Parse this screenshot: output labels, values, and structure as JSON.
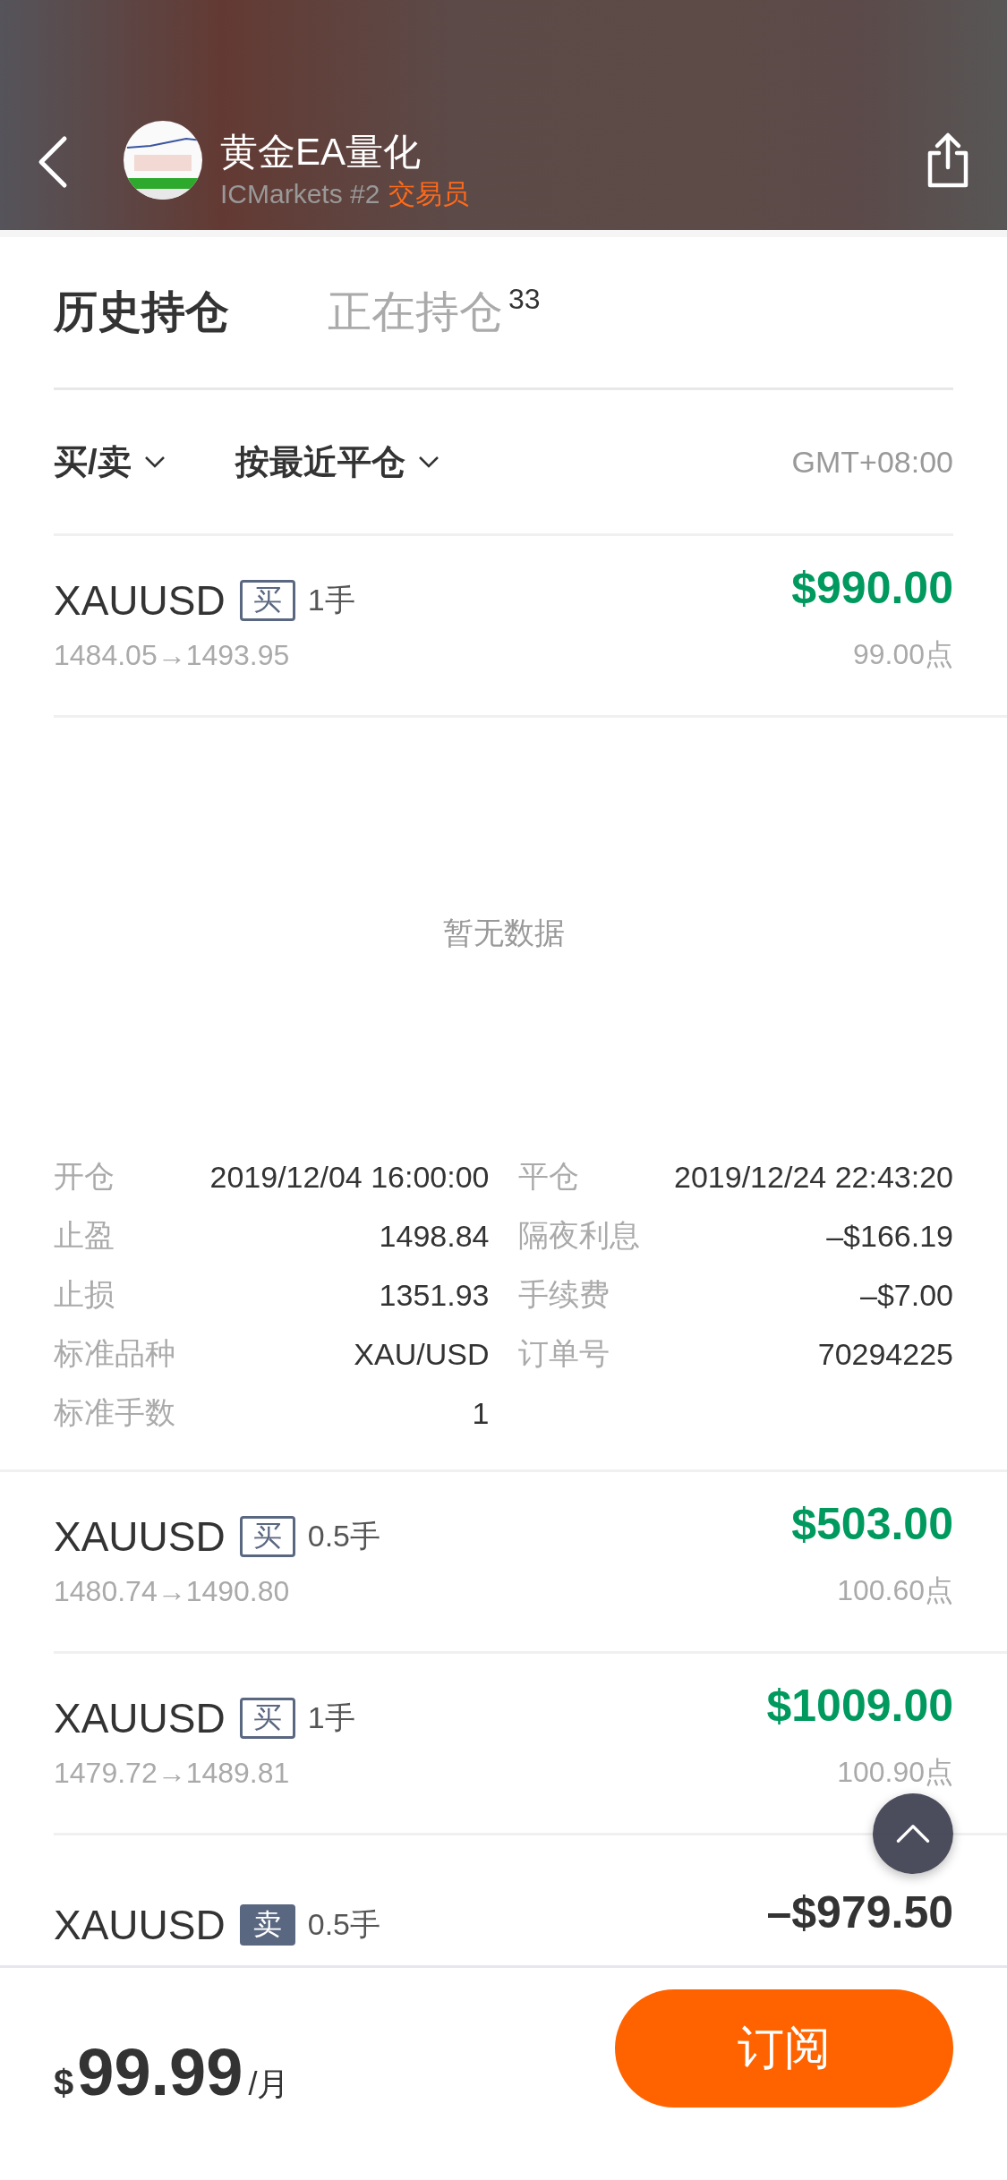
{
  "header": {
    "title": "黄金EA量化",
    "broker": "ICMarkets #2",
    "role": "交易员"
  },
  "tabs": [
    {
      "label": "历史持仓",
      "selected": true
    },
    {
      "label": "正在持仓",
      "count": "33",
      "selected": false
    }
  ],
  "filters": {
    "side": "买/卖",
    "sort": "按最近平仓",
    "timezone": "GMT+08:00"
  },
  "trades": [
    {
      "symbol": "XAUUSD",
      "kind": "buy",
      "side": "买",
      "lots": "1手",
      "prices": "1484.05→1493.95",
      "amount": "$990.00",
      "loss": false,
      "points": "99.00点",
      "empty_text": "暂无数据",
      "details": [
        {
          "label": "开仓",
          "value": "2019/12/04 16:00:00"
        },
        {
          "label": "平仓",
          "value": "2019/12/24 22:43:20"
        },
        {
          "label": "止盈",
          "value": "1498.84"
        },
        {
          "label": "隔夜利息",
          "value": "–$166.19"
        },
        {
          "label": "止损",
          "value": "1351.93"
        },
        {
          "label": "手续费",
          "value": "–$7.00"
        },
        {
          "label": "标准品种",
          "value": "XAU/USD"
        },
        {
          "label": "订单号",
          "value": "70294225"
        },
        {
          "label": "标准手数",
          "value": "1"
        }
      ]
    },
    {
      "symbol": "XAUUSD",
      "kind": "buy",
      "side": "买",
      "lots": "0.5手",
      "prices": "1480.74→1490.80",
      "amount": "$503.00",
      "loss": false,
      "points": "100.60点"
    },
    {
      "symbol": "XAUUSD",
      "kind": "buy",
      "side": "买",
      "lots": "1手",
      "prices": "1479.72→1489.81",
      "amount": "$1009.00",
      "loss": false,
      "points": "100.90点"
    },
    {
      "symbol": "XAUUSD",
      "kind": "sell",
      "side": "卖",
      "lots": "0.5手",
      "amount": "–$979.50",
      "loss": true
    }
  ],
  "footer": {
    "currency": "$",
    "price": "99.99",
    "period": "/月",
    "button": "订阅"
  }
}
